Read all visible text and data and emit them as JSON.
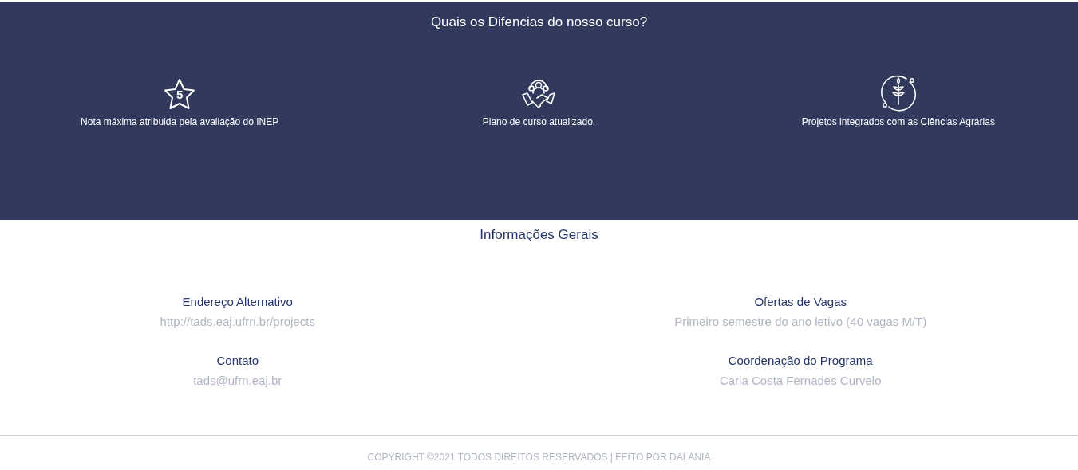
{
  "features": {
    "title": "Quais os Difencias do nosso curso?",
    "items": [
      {
        "kind": "star",
        "icon_text": "5",
        "text": "Nota máxima atribuida pela avaliação do INEP"
      },
      {
        "kind": "teamwork",
        "text": "Plano de curso atualizado."
      },
      {
        "kind": "wheat",
        "text": "Projetos integrados com as Ciências Agrárias"
      }
    ]
  },
  "info": {
    "title": "Informações Gerais",
    "items": [
      {
        "label": "Endereço Alternativo",
        "value": "http://tads.eaj.ufrn.br/projects"
      },
      {
        "label": "Ofertas de Vagas",
        "value": "Primeiro semestre do ano letivo (40 vagas M/T)"
      },
      {
        "label": "Contato",
        "value": "tads@ufrn.eaj.br"
      },
      {
        "label": "Coordenação do Programa",
        "value": "Carla Costa Fernades Curvelo"
      }
    ]
  },
  "footer": "COPYRIGHT ©2021 TODOS DIREITOS RESERVADOS | FEITO POR DALANIA"
}
